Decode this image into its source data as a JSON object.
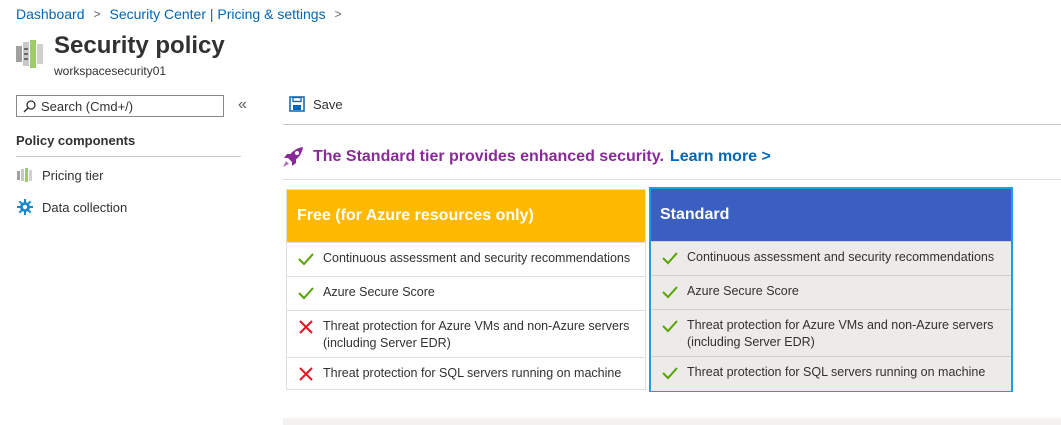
{
  "breadcrumb": {
    "items": [
      "Dashboard",
      "Security Center | Pricing & settings"
    ],
    "separator": ">"
  },
  "header": {
    "title": "Security policy",
    "subtitle": "workspacesecurity01"
  },
  "sidebar": {
    "search_placeholder": "Search (Cmd+/)",
    "collapse_glyph": "«",
    "section_heading": "Policy components",
    "items": [
      {
        "label": "Pricing tier",
        "icon": "pricing-tier-icon"
      },
      {
        "label": "Data collection",
        "icon": "gear-icon"
      }
    ]
  },
  "toolbar": {
    "save_label": "Save"
  },
  "banner": {
    "text": "The Standard tier provides enhanced security.",
    "link": "Learn more >"
  },
  "tiers": {
    "free": {
      "title": "Free (for Azure resources only)",
      "features": [
        {
          "text": "Continuous assessment and security recommendations",
          "included": true
        },
        {
          "text": "Azure Secure Score",
          "included": true
        },
        {
          "text": "Threat protection for Azure VMs and non-Azure servers (including Server EDR)",
          "included": false
        },
        {
          "text": "Threat protection for SQL servers running on machine",
          "included": false
        }
      ]
    },
    "standard": {
      "title": "Standard",
      "selected": true,
      "features": [
        {
          "text": "Continuous assessment and security recommendations",
          "included": true
        },
        {
          "text": "Azure Secure Score",
          "included": true
        },
        {
          "text": "Threat protection for Azure VMs and non-Azure servers (including Server EDR)",
          "included": true
        },
        {
          "text": "Threat protection for SQL servers running on machine",
          "included": true
        }
      ]
    }
  },
  "colors": {
    "link": "#0067b8",
    "free_header": "#ffb900",
    "standard_header": "#3b5fc0",
    "selected_border": "#1ba1e2",
    "check": "#57a300",
    "cross": "#e81123",
    "banner_text": "#8a2a9a"
  }
}
